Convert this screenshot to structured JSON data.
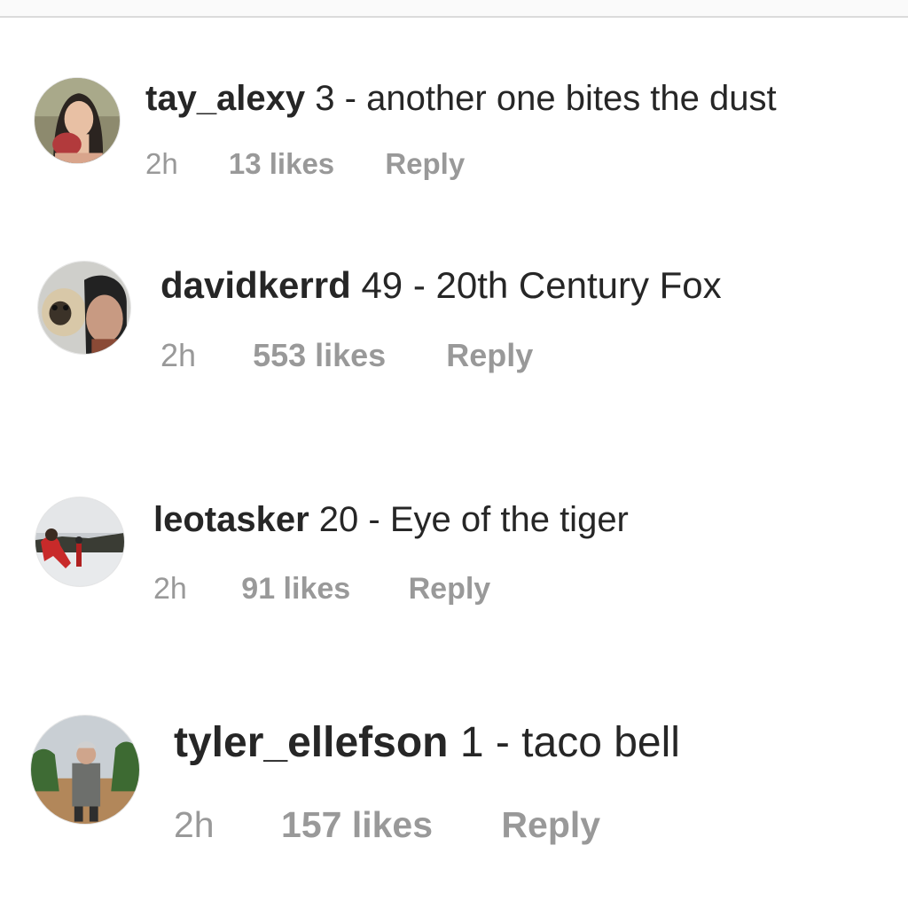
{
  "comments": [
    {
      "username": "tay_alexy",
      "text": "3 - another one bites the dust",
      "time": "2h",
      "likes": "13 likes",
      "reply": "Reply",
      "avatar_icon": "user-photo-woman-holding-football"
    },
    {
      "username": "davidkerrd",
      "text": "49 - 20th Century Fox",
      "time": "2h",
      "likes": "553 likes",
      "reply": "Reply",
      "avatar_icon": "user-photo-man-with-pug"
    },
    {
      "username": "leotasker",
      "text": "20 - Eye of the tiger",
      "time": "2h",
      "likes": "91 likes",
      "reply": "Reply",
      "avatar_icon": "user-photo-outdoors-snow"
    },
    {
      "username": "tyler_ellefson",
      "text": "1 - taco bell",
      "time": "2h",
      "likes": "157 likes",
      "reply": "Reply",
      "avatar_icon": "user-photo-hiker-trees"
    }
  ],
  "colors": {
    "text": "#262626",
    "meta": "#999999",
    "divider": "#dbdbdb"
  }
}
